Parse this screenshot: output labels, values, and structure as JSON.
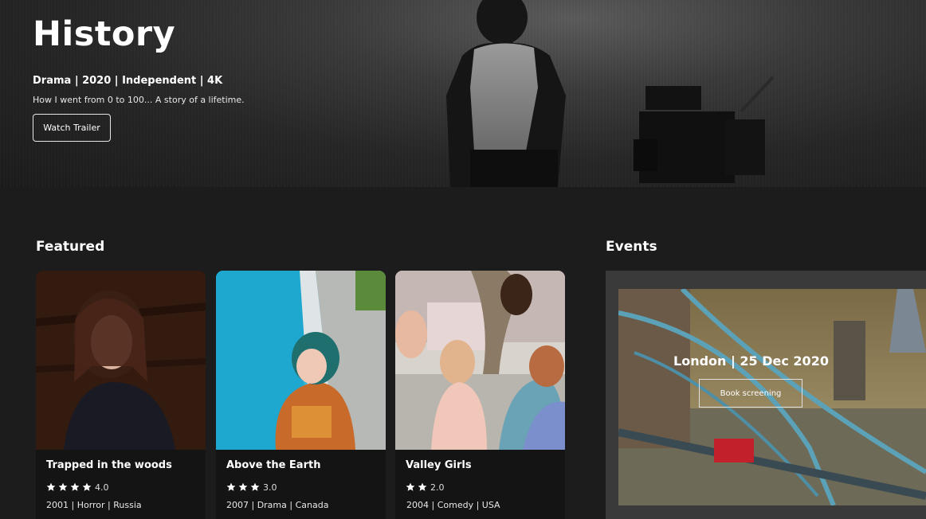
{
  "hero": {
    "title": "History",
    "meta": "Drama | 2020 | Independent | 4K",
    "tagline": "How I went from 0 to 100... A story of a lifetime.",
    "button_label": "Watch Trailer"
  },
  "featured": {
    "heading": "Featured",
    "cards": [
      {
        "title": "Trapped in the woods",
        "stars": 4,
        "rating": "4.0",
        "info": "2001 | Horror | Russia"
      },
      {
        "title": "Above the Earth",
        "stars": 3,
        "rating": "3.0",
        "info": "2007 | Drama | Canada"
      },
      {
        "title": "Valley Girls",
        "stars": 2,
        "rating": "2.0",
        "info": "2004 | Comedy | USA"
      }
    ]
  },
  "events": {
    "heading": "Events",
    "title": "London | 25 Dec 2020",
    "button_label": "Book screening"
  },
  "colors": {
    "background": "#1c1c1c",
    "card_background": "#141414",
    "events_panel": "#3a3a3a",
    "text": "#ffffff"
  },
  "icons": {
    "rating": "star-icon"
  }
}
